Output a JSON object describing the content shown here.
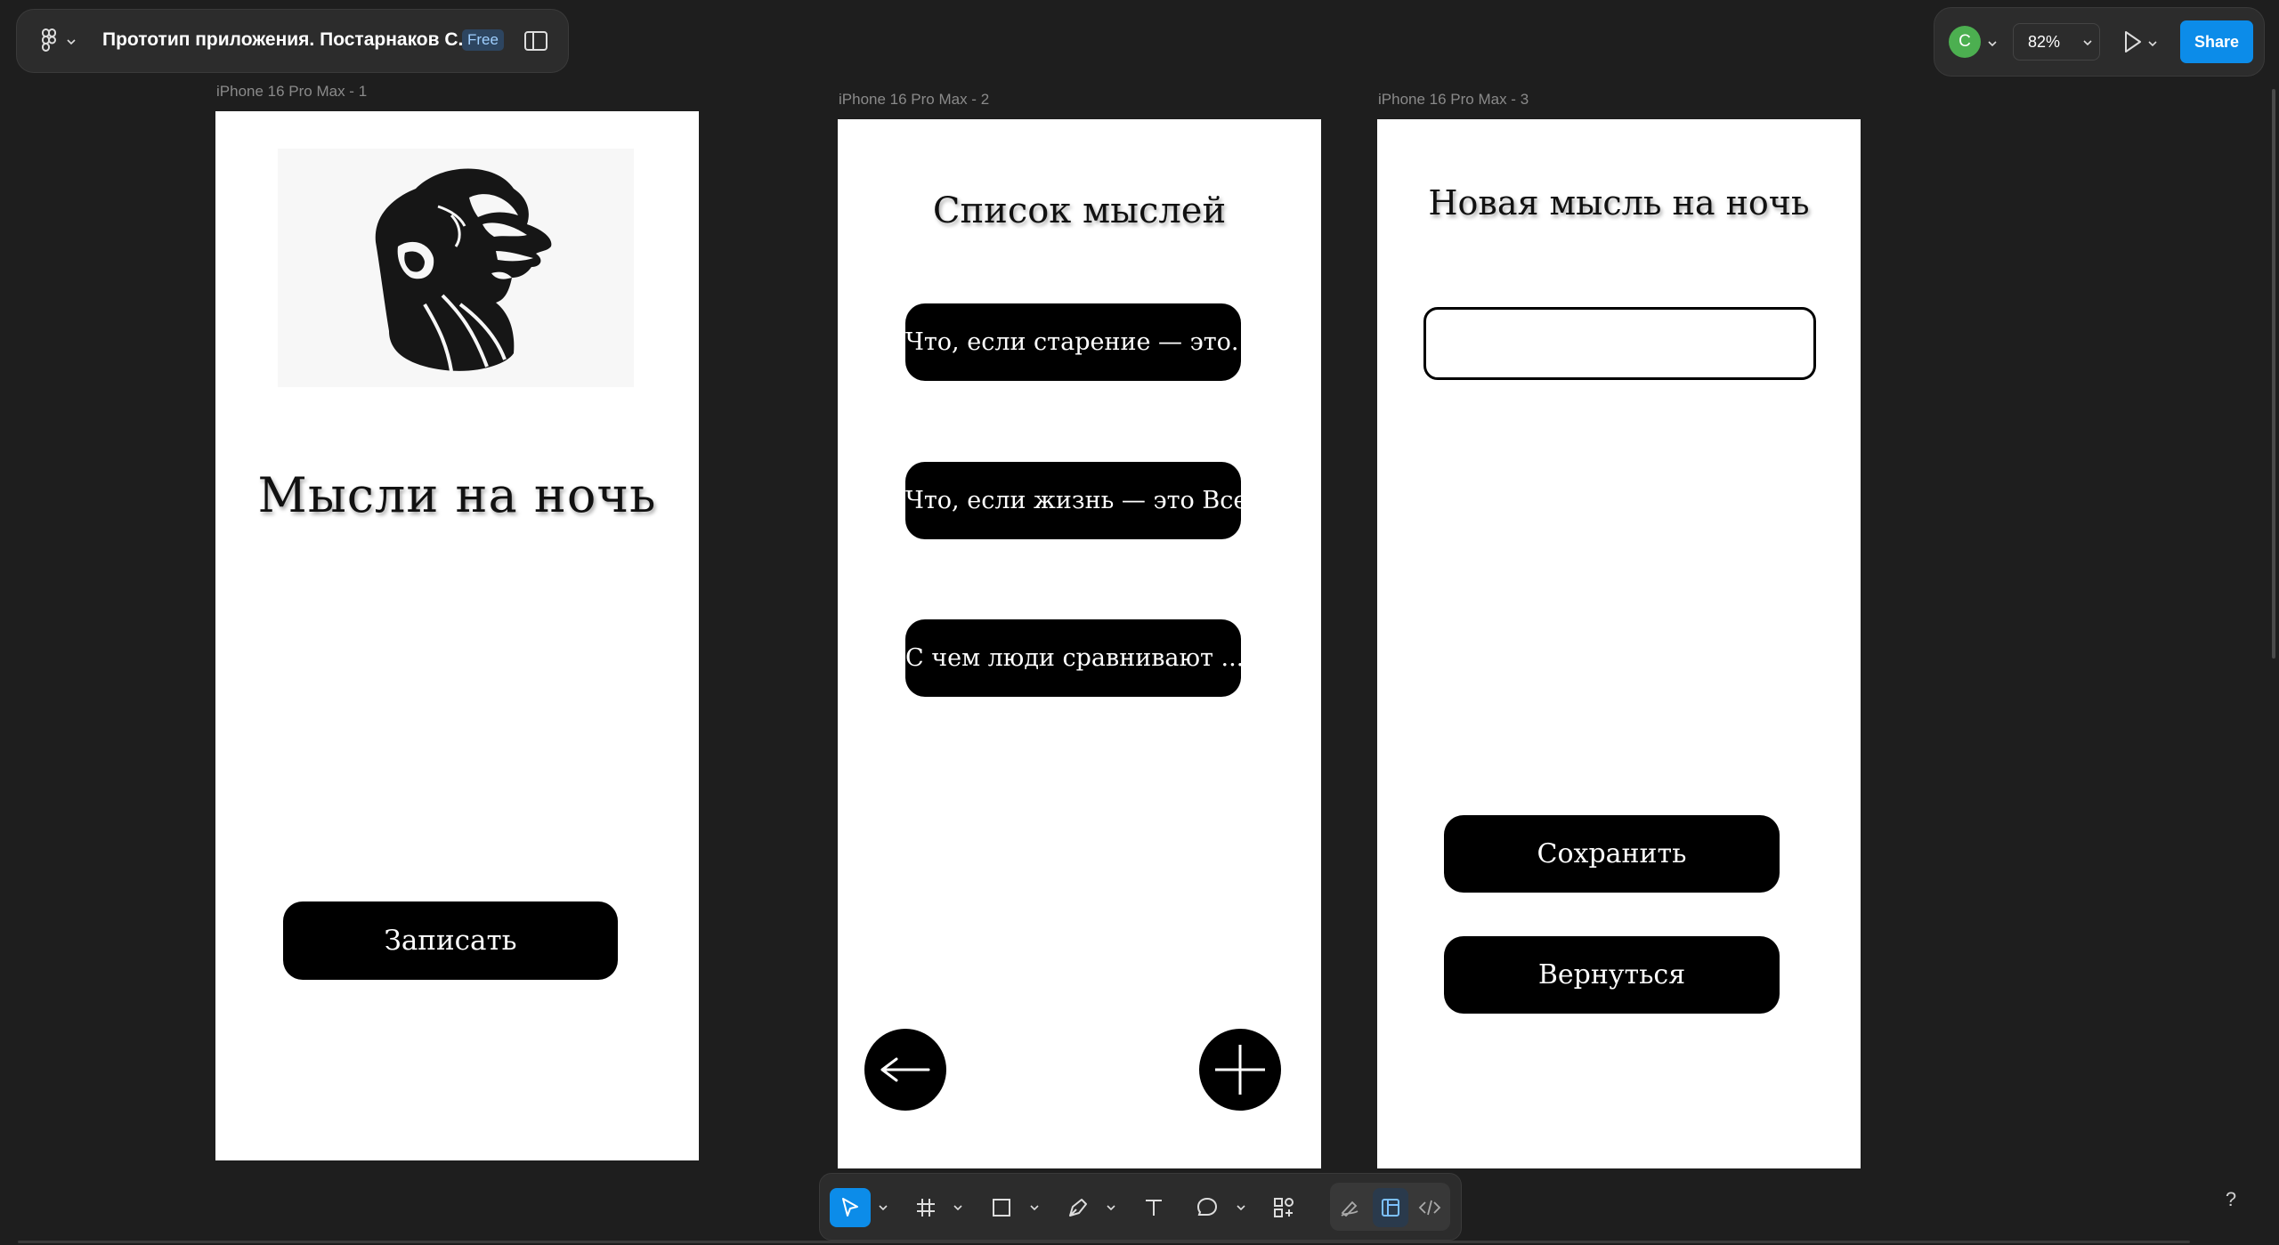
{
  "toolbar": {
    "file_title": "Прототип приложения. Постарнаков С.В",
    "plan_badge": "Free",
    "user_initial": "C",
    "zoom": "82%",
    "share_label": "Share"
  },
  "colors": {
    "accent": "#0c8ce9",
    "avatar": "#4caf50",
    "canvas": "#1e1e1e"
  },
  "frames": [
    {
      "label": "iPhone 16 Pro Max - 1",
      "title": "Мысли на ночь",
      "button": "Записать"
    },
    {
      "label": "iPhone 16 Pro Max - 2",
      "title": "Список мыслей",
      "items": [
        "Что, если старение — это...",
        "Что, если жизнь — это Все...",
        "С чем люди сравнивают ..."
      ]
    },
    {
      "label": "iPhone 16 Pro Max - 3",
      "title": "Новая мысль на ночь",
      "input_value": "",
      "save": "Сохранить",
      "back": "Вернуться"
    }
  ],
  "bottom_tools": [
    "move-tool",
    "frame-tool",
    "rectangle-tool",
    "pen-tool",
    "text-tool",
    "comment-tool",
    "assets-tool",
    "draw-mode",
    "design-mode",
    "dev-mode"
  ],
  "help": "?"
}
